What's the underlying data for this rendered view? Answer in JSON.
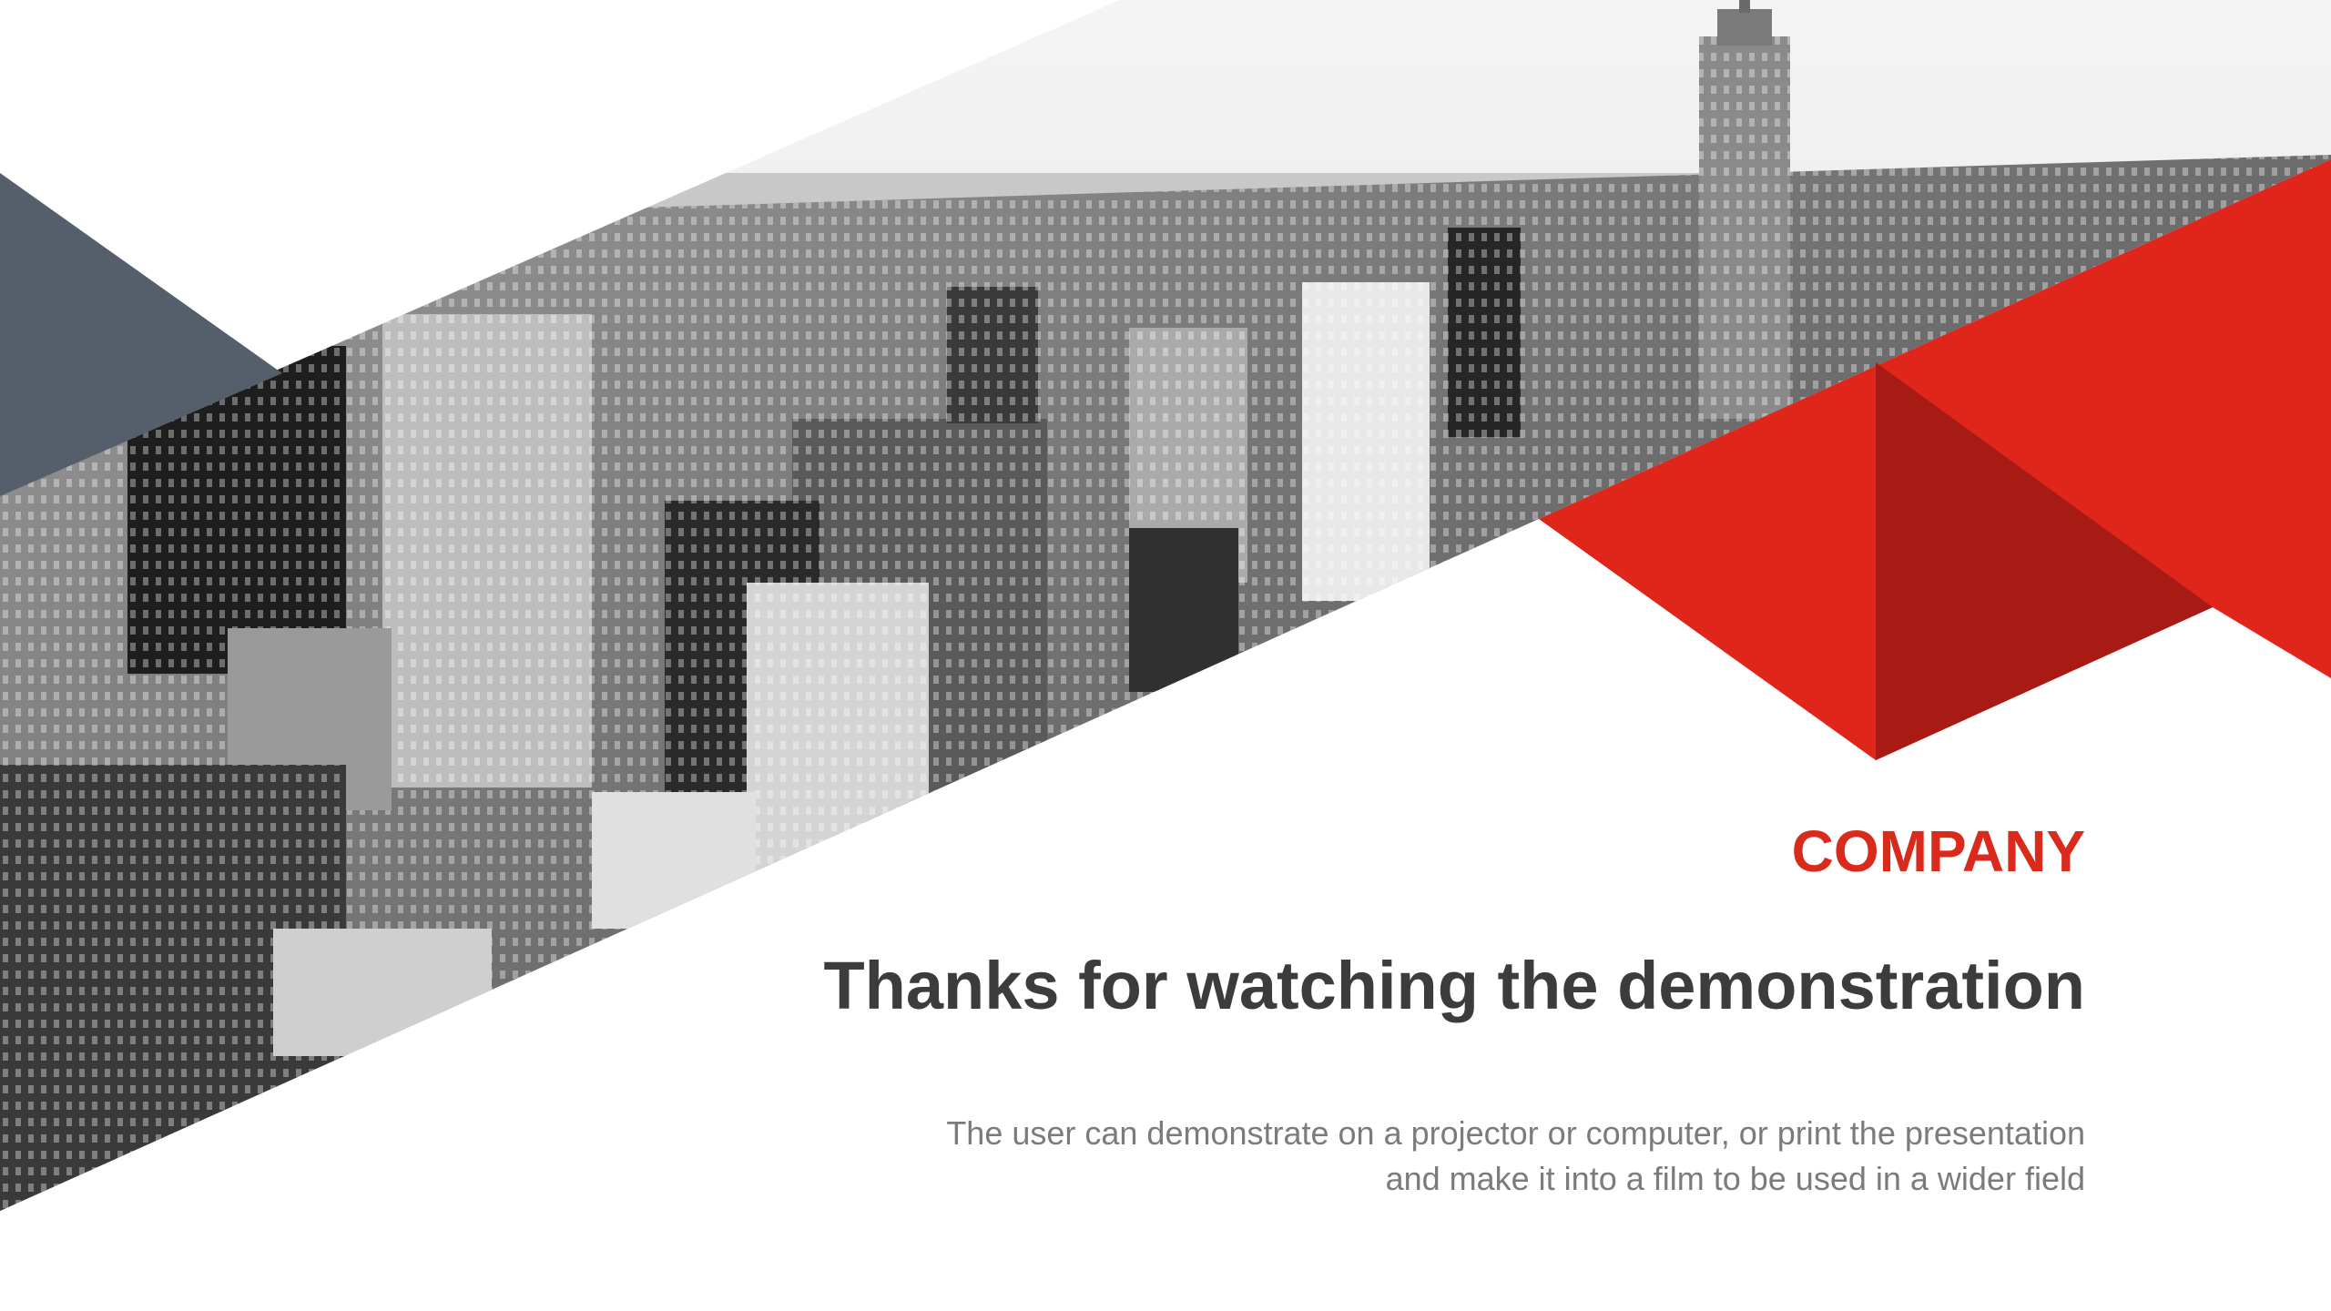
{
  "colors": {
    "accent_red": "#e0251a",
    "accent_dark_red": "#a81b14",
    "slate": "#555e6b",
    "title_text": "#3c3c3c",
    "body_text": "#7b7b7b"
  },
  "slide": {
    "company": "COMPANY",
    "title": "Thanks for watching the demonstration",
    "subtitle_lines": [
      "The user can demonstrate on a projector or computer, or print the presentation",
      "and make it into a film to be used in a wider field"
    ]
  }
}
